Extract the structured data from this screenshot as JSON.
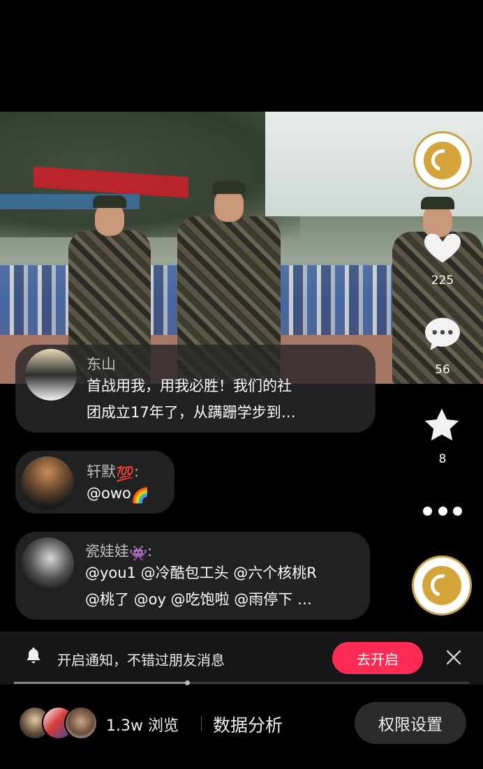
{
  "comments": [
    {
      "username": "东山",
      "text_line1": "首战用我，用我必胜！我们的社",
      "text_line2": "团成立17年了，从蹒跚学步到…"
    },
    {
      "username": "轩默",
      "username_emoji": "💯",
      "text": "@owo",
      "text_emoji": "🌈"
    },
    {
      "username": "瓷娃娃",
      "username_emoji": "👾",
      "text_line1": "@you1 @冷酷包工头 @六个核桃R",
      "text_line2": "@桃了 @oy @吃饱啦 @雨停下 …"
    }
  ],
  "actions": {
    "likes": "225",
    "comments": "56",
    "favorites": "8"
  },
  "notification": {
    "text": "开启通知，不错过朋友消息",
    "button_label": "去开启"
  },
  "progress": {
    "fraction": 0.38
  },
  "footer": {
    "views": "1.3w 浏览",
    "analysis_label": "数据分析",
    "permission_button": "权限设置"
  },
  "colors": {
    "accent": "#fe2c55",
    "logo_gold": "#d4a53a"
  }
}
